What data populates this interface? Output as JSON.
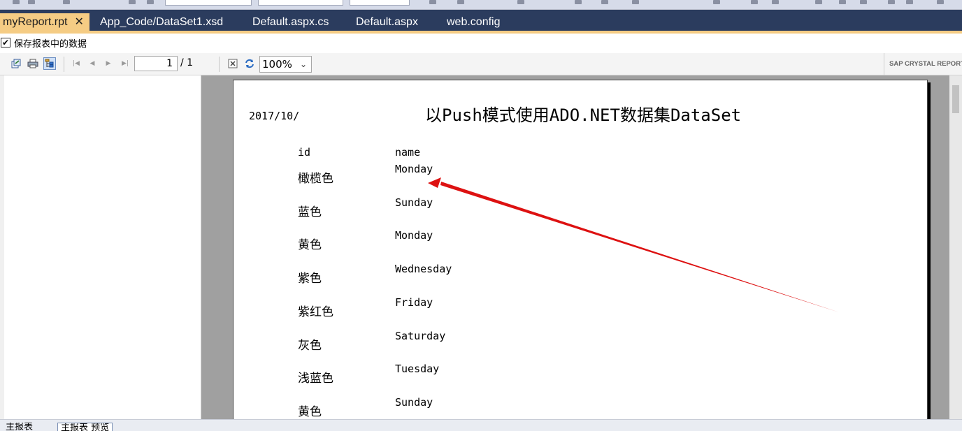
{
  "tabs": [
    {
      "label": "myReport.rpt",
      "active": true,
      "close": "✕"
    },
    {
      "label": "App_Code/DataSet1.xsd",
      "active": false
    },
    {
      "label": "Default.aspx.cs",
      "active": false
    },
    {
      "label": "Default.aspx",
      "active": false
    },
    {
      "label": "web.config",
      "active": false
    }
  ],
  "save_data": {
    "checked": true,
    "label": "保存报表中的数据"
  },
  "viewer_toolbar": {
    "page_value": "1",
    "page_total": "/ 1",
    "zoom": "100%",
    "brand": "SAP CRYSTAL REPORT"
  },
  "report": {
    "date": "2017/10/",
    "title_prefix": "以",
    "title_word": "Push",
    "title_mid": "模式使用",
    "title_ado": "ADO.NET",
    "title_mid2": "数据集",
    "title_end": "DataSet",
    "headers": {
      "id": "id",
      "name": "name"
    },
    "rows": [
      {
        "id": "橄榄色",
        "name": "Monday"
      },
      {
        "id": "蓝色",
        "name": "Sunday"
      },
      {
        "id": "黄色",
        "name": "Monday"
      },
      {
        "id": "紫色",
        "name": "Wednesday"
      },
      {
        "id": "紫红色",
        "name": "Friday"
      },
      {
        "id": "灰色",
        "name": "Saturday"
      },
      {
        "id": "浅蓝色",
        "name": "Tuesday"
      },
      {
        "id": "黄色",
        "name": "Sunday"
      }
    ]
  },
  "colors": {
    "tab_bar": "#2b3c5e",
    "tab_active": "#f5cc84",
    "annotation_arrow": "#dd1111"
  },
  "bottom_tabs": [
    {
      "label": "主报表",
      "active": false
    },
    {
      "label": "主报表 预览",
      "active": true
    }
  ]
}
